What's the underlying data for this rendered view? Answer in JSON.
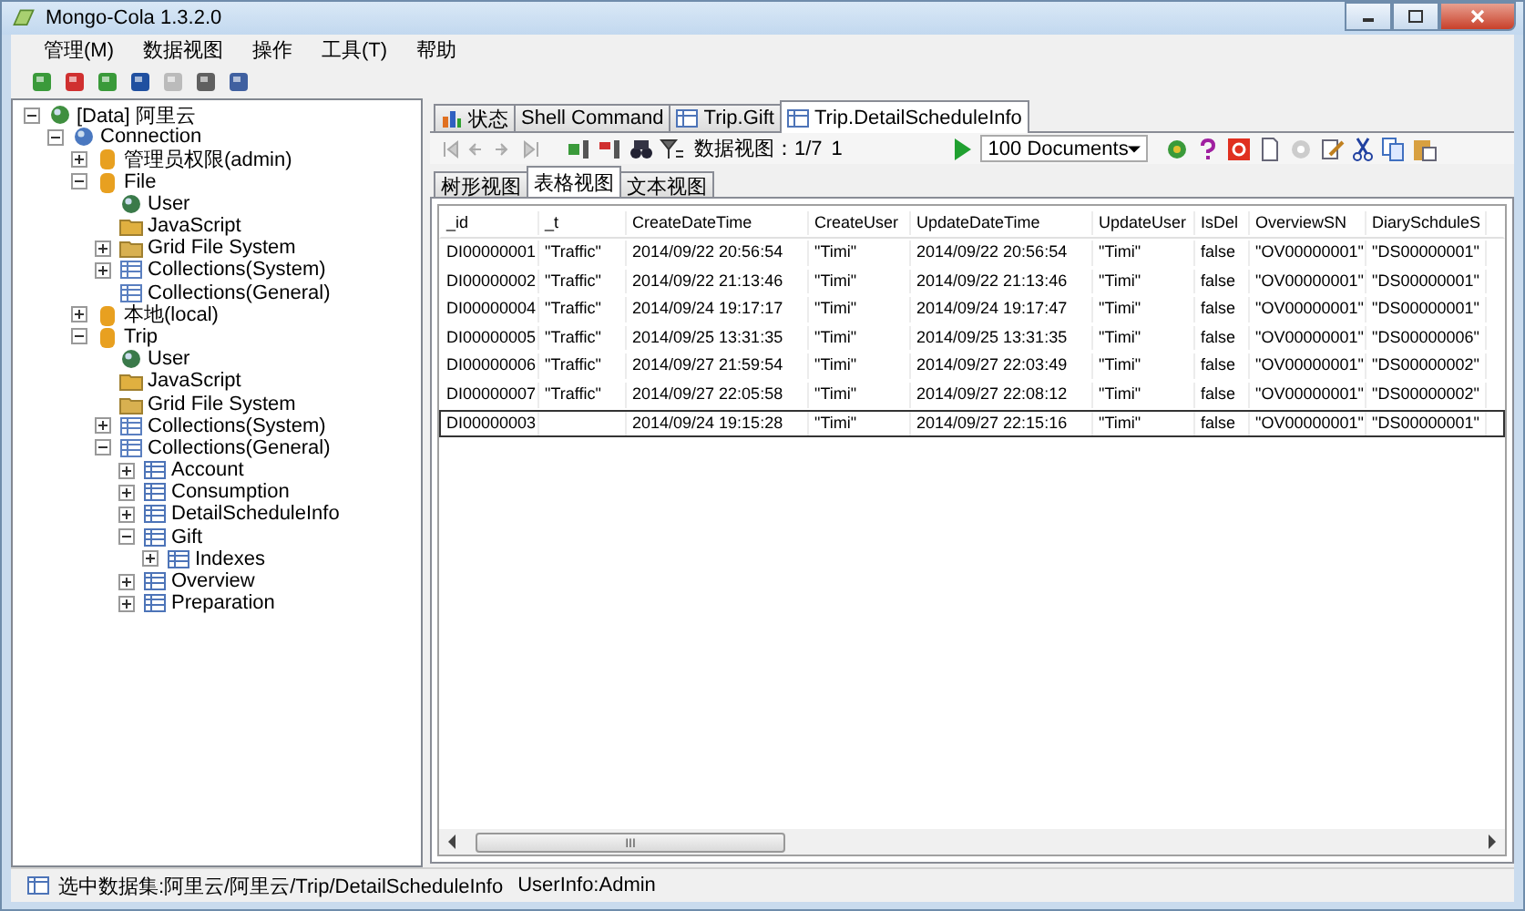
{
  "window": {
    "title": "Mongo-Cola  1.3.2.0"
  },
  "menu": [
    "管理(M)",
    "数据视图",
    "操作",
    "工具(T)",
    "帮助"
  ],
  "tree": [
    {
      "label": "[Data] 阿里云",
      "kind": "server",
      "expandable": true,
      "expanded": true,
      "children": [
        {
          "label": "Connection",
          "kind": "connection",
          "expandable": true,
          "expanded": true,
          "children": [
            {
              "label": "管理员权限(admin)",
              "kind": "database",
              "expandable": true,
              "expanded": false
            },
            {
              "label": "File",
              "kind": "database",
              "expandable": true,
              "expanded": true,
              "children": [
                {
                  "label": "User",
                  "kind": "user",
                  "expandable": false
                },
                {
                  "label": "JavaScript",
                  "kind": "script",
                  "expandable": false
                },
                {
                  "label": "Grid File System",
                  "kind": "gridfs",
                  "expandable": true,
                  "expanded": false
                },
                {
                  "label": "Collections(System)",
                  "kind": "collections",
                  "expandable": true,
                  "expanded": false
                },
                {
                  "label": "Collections(General)",
                  "kind": "collections",
                  "expandable": false
                }
              ]
            },
            {
              "label": "本地(local)",
              "kind": "database",
              "expandable": true,
              "expanded": false
            },
            {
              "label": "Trip",
              "kind": "database",
              "expandable": true,
              "expanded": true,
              "children": [
                {
                  "label": "User",
                  "kind": "user",
                  "expandable": false
                },
                {
                  "label": "JavaScript",
                  "kind": "script",
                  "expandable": false
                },
                {
                  "label": "Grid File System",
                  "kind": "gridfs",
                  "expandable": false
                },
                {
                  "label": "Collections(System)",
                  "kind": "collections",
                  "expandable": true,
                  "expanded": false
                },
                {
                  "label": "Collections(General)",
                  "kind": "collections",
                  "expandable": true,
                  "expanded": true,
                  "children": [
                    {
                      "label": "Account",
                      "kind": "collection",
                      "expandable": true,
                      "expanded": false
                    },
                    {
                      "label": "Consumption",
                      "kind": "collection",
                      "expandable": true,
                      "expanded": false
                    },
                    {
                      "label": "DetailScheduleInfo",
                      "kind": "collection",
                      "expandable": true,
                      "expanded": false
                    },
                    {
                      "label": "Gift",
                      "kind": "collection",
                      "expandable": true,
                      "expanded": true,
                      "children": [
                        {
                          "label": "Indexes",
                          "kind": "collection",
                          "expandable": true,
                          "expanded": false
                        }
                      ]
                    },
                    {
                      "label": "Overview",
                      "kind": "collection",
                      "expandable": true,
                      "expanded": false
                    },
                    {
                      "label": "Preparation",
                      "kind": "collection",
                      "expandable": true,
                      "expanded": false
                    }
                  ]
                }
              ]
            }
          ]
        }
      ]
    }
  ],
  "tabs": [
    {
      "label": "状态",
      "kind": "chart",
      "selected": false
    },
    {
      "label": "Shell Command",
      "kind": "plain",
      "selected": false
    },
    {
      "label": "Trip.Gift",
      "kind": "table",
      "selected": false
    },
    {
      "label": "Trip.DetailScheduleInfo",
      "kind": "table",
      "selected": true
    }
  ],
  "data_toolbar": {
    "page_label": "数据视图：1/7",
    "page_value": "1",
    "page_size": "100  Documents"
  },
  "view_tabs": [
    {
      "label": "树形视图",
      "selected": false
    },
    {
      "label": "表格视图",
      "selected": true
    },
    {
      "label": "文本视图",
      "selected": false
    }
  ],
  "table": {
    "columns": [
      "_id",
      "_t",
      "CreateDateTime",
      "CreateUser",
      "UpdateDateTime",
      "UpdateUser",
      "IsDel",
      "OverviewSN",
      "DiarySchduleS"
    ],
    "rows": [
      {
        "selected": false,
        "cells": [
          "DI00000001",
          "\"Traffic\"",
          "2014/09/22 20:56:54",
          "\"Timi\"",
          "2014/09/22 20:56:54",
          "\"Timi\"",
          "false",
          "\"OV00000001\"",
          "\"DS00000001\""
        ]
      },
      {
        "selected": false,
        "cells": [
          "DI00000002",
          "\"Traffic\"",
          "2014/09/22 21:13:46",
          "\"Timi\"",
          "2014/09/22 21:13:46",
          "\"Timi\"",
          "false",
          "\"OV00000001\"",
          "\"DS00000001\""
        ]
      },
      {
        "selected": false,
        "cells": [
          "DI00000004",
          "\"Traffic\"",
          "2014/09/24 19:17:17",
          "\"Timi\"",
          "2014/09/24 19:17:47",
          "\"Timi\"",
          "false",
          "\"OV00000001\"",
          "\"DS00000001\""
        ]
      },
      {
        "selected": false,
        "cells": [
          "DI00000005",
          "\"Traffic\"",
          "2014/09/25 13:31:35",
          "\"Timi\"",
          "2014/09/25 13:31:35",
          "\"Timi\"",
          "false",
          "\"OV00000001\"",
          "\"DS00000006\""
        ]
      },
      {
        "selected": false,
        "cells": [
          "DI00000006",
          "\"Traffic\"",
          "2014/09/27 21:59:54",
          "\"Timi\"",
          "2014/09/27 22:03:49",
          "\"Timi\"",
          "false",
          "\"OV00000001\"",
          "\"DS00000002\""
        ]
      },
      {
        "selected": false,
        "cells": [
          "DI00000007",
          "\"Traffic\"",
          "2014/09/27 22:05:58",
          "\"Timi\"",
          "2014/09/27 22:08:12",
          "\"Timi\"",
          "false",
          "\"OV00000001\"",
          "\"DS00000002\""
        ]
      },
      {
        "selected": true,
        "cells": [
          "DI00000003",
          "",
          "2014/09/24 19:15:28",
          "\"Timi\"",
          "2014/09/27 22:15:16",
          "\"Timi\"",
          "false",
          "\"OV00000001\"",
          "\"DS00000001\""
        ]
      }
    ]
  },
  "scroll_grip": "III",
  "status_bar": {
    "selection": "选中数据集:阿里云/阿里云/Trip/DetailScheduleInfo",
    "user": "UserInfo:Admin"
  }
}
